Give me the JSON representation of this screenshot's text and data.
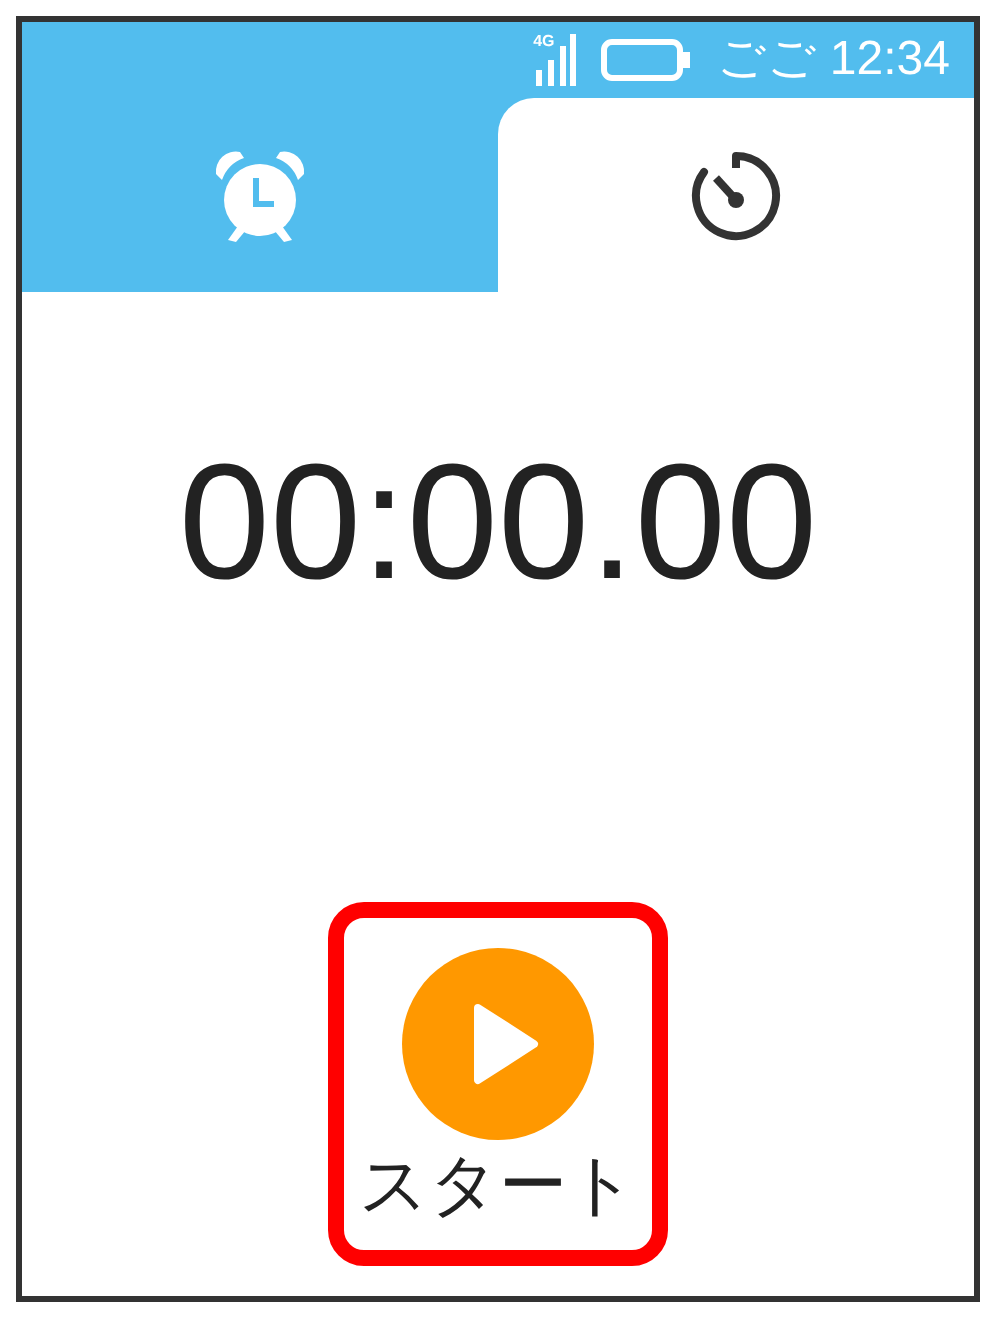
{
  "status_bar": {
    "network": "4G",
    "time": "ごご 12:34"
  },
  "tabs": [
    {
      "kind": "alarm",
      "selected": false
    },
    {
      "kind": "stopwatch",
      "selected": true
    }
  ],
  "timer_display": "00:00.00",
  "start_button": {
    "label": "スタート",
    "highlighted": true
  }
}
